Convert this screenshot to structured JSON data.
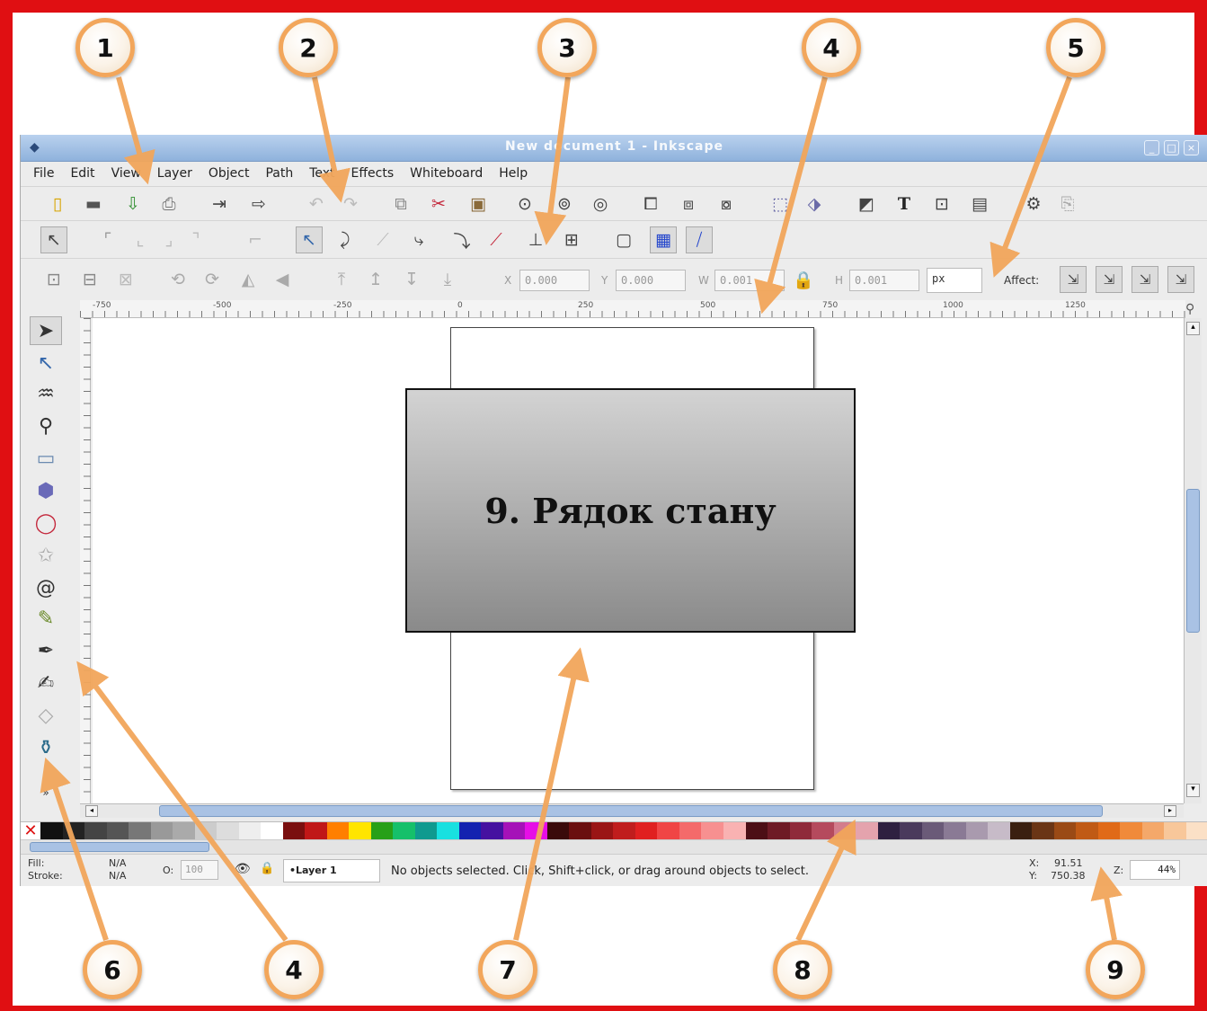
{
  "window": {
    "title": "New document 1 - Inkscape",
    "controls": [
      "_",
      "□",
      "×"
    ]
  },
  "menu": [
    "File",
    "Edit",
    "View",
    "Layer",
    "Object",
    "Path",
    "Text",
    "Effects",
    "Whiteboard",
    "Help"
  ],
  "commands_bar_icons": [
    "new-icon",
    "open-icon",
    "save-icon",
    "print-icon",
    "import-icon",
    "export-icon",
    "undo-icon",
    "redo-icon",
    "copy-icon",
    "cut-icon",
    "paste-icon",
    "zoom-selection-icon",
    "zoom-drawing-icon",
    "zoom-page-icon",
    "duplicate-icon",
    "clone-icon",
    "unlink-clone-icon",
    "group-icon",
    "ungroup-icon",
    "fill-stroke-icon",
    "text-icon",
    "xml-editor-icon",
    "align-icon",
    "preferences-icon",
    "document-props-icon"
  ],
  "snap_bar_icons": [
    "snap-toggle-icon",
    "snap-bbox-icon",
    "snap-nodes-icon",
    "snap-guides-icon",
    "snap-grid-icon",
    "snap-center-icon",
    "snap-paths-icon",
    "snap-intersections-icon",
    "snap-cusp-icon",
    "snap-smooth-icon",
    "snap-midpoint-icon",
    "snap-object-midpoint-icon",
    "snap-rotation-icon",
    "snap-page-icon",
    "snap-grid-toggle-icon",
    "snap-guide-toggle-icon"
  ],
  "tool_controls": {
    "x_label": "X",
    "x_value": "0.000",
    "y_label": "Y",
    "y_value": "0.000",
    "w_label": "W",
    "w_value": "0.001",
    "h_label": "H",
    "h_value": "0.001",
    "unit": "px",
    "affect_label": "Affect:"
  },
  "ruler_labels": [
    "-750",
    "-500",
    "-250",
    "0",
    "250",
    "500",
    "750",
    "1000",
    "1250"
  ],
  "tools": [
    "selector-icon",
    "node-icon",
    "tweak-icon",
    "zoom-icon",
    "rectangle-icon",
    "3d-box-icon",
    "ellipse-icon",
    "star-icon",
    "spiral-icon",
    "pencil-icon",
    "pen-icon",
    "calligraphy-icon",
    "eraser-icon",
    "paint-bucket-icon"
  ],
  "palette": [
    "#111111",
    "#222222",
    "#444444",
    "#555555",
    "#777777",
    "#999999",
    "#aaaaaa",
    "#cccccc",
    "#dddddd",
    "#eeeeee",
    "#ffffff",
    "#7a0f0f",
    "#c01717",
    "#ff7f00",
    "#ffe500",
    "#27a018",
    "#15c06a",
    "#0f9a8f",
    "#18e0e0",
    "#1322b0",
    "#4511a0",
    "#a512b8",
    "#e60ee6",
    "#3a0a0a",
    "#6a0f0f",
    "#9a1515",
    "#c01d1d",
    "#e02020",
    "#f04545",
    "#f46a6a",
    "#f79090",
    "#f9b2b2",
    "#4c0e15",
    "#6e1a25",
    "#8f2a3a",
    "#b54a5d",
    "#d37c8c",
    "#e4a3ad",
    "#2e2040",
    "#4a3a5c",
    "#6a5a78",
    "#8a7a95",
    "#a99aae",
    "#c7bbc8",
    "#3a2010",
    "#6a3515",
    "#9a4a15",
    "#c05a15",
    "#e06a18",
    "#f08a3a",
    "#f4a86a",
    "#f8c79a",
    "#fbe0c6"
  ],
  "statusbar": {
    "fill_label": "Fill:",
    "fill_value": "N/A",
    "stroke_label": "Stroke:",
    "stroke_value": "N/A",
    "opacity_label": "O:",
    "opacity_value": "100",
    "layer": "•Layer 1",
    "message": "No objects selected. Click, Shift+click, or drag around objects to select.",
    "x_label": "X:",
    "x_value": "91.51",
    "y_label": "Y:",
    "y_value": "750.38",
    "zoom_label": "Z:",
    "zoom_value": "44%"
  },
  "callout_numbers": [
    "1",
    "2",
    "3",
    "4",
    "5",
    "6",
    "4",
    "7",
    "8",
    "9"
  ],
  "overlay_text": "9. Рядок стану",
  "colors": {
    "frame": "#e00f12",
    "arrow": "#f2a65b",
    "titlebar": "#9bbbe2"
  }
}
